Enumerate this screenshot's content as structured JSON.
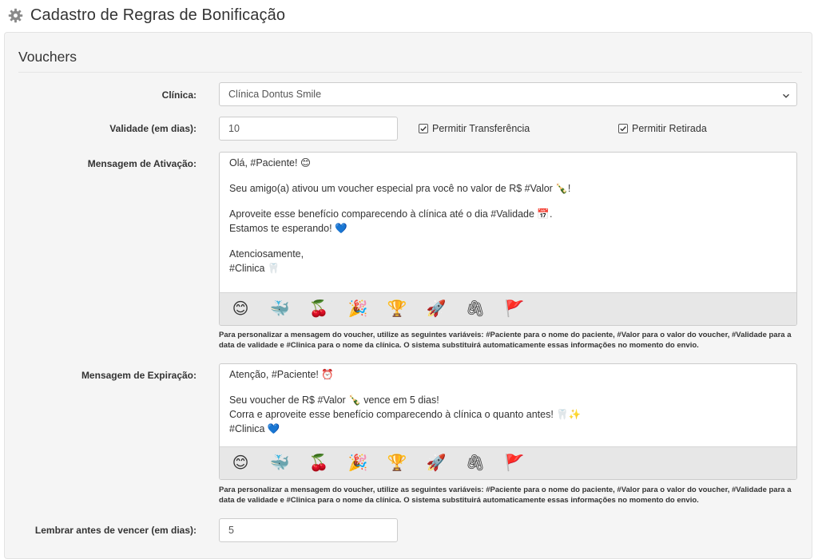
{
  "page": {
    "title": "Cadastro de Regras de Bonificação",
    "title_icon": "gear-icon"
  },
  "section": {
    "legend": "Vouchers"
  },
  "form": {
    "clinica": {
      "label": "Clínica:",
      "value": "Clínica Dontus Smile"
    },
    "validade": {
      "label": "Validade (em dias):",
      "value": "10"
    },
    "permitir_transferencia": {
      "label": "Permitir Transferência",
      "checked": true
    },
    "permitir_retirada": {
      "label": "Permitir Retirada",
      "checked": true
    },
    "ativacao": {
      "label": "Mensagem de Ativação:",
      "lines": [
        "Olá, #Paciente! 😊",
        "",
        "Seu amigo(a) ativou um voucher especial pra você no valor de R$ #Valor 🍾!",
        "",
        "Aproveite esse benefício comparecendo à clínica até o dia #Validade 📅.",
        "Estamos te esperando! 💙",
        "",
        "Atenciosamente,",
        "#Clinica 🦷"
      ]
    },
    "expiracao": {
      "label": "Mensagem de Expiração:",
      "lines": [
        "Atenção, #Paciente! ⏰",
        "",
        "Seu voucher de R$ #Valor 🍾 vence em 5 dias!",
        "Corra e aproveite esse benefício comparecendo à clínica o quanto antes! 🦷✨",
        "#Clinica 💙"
      ]
    },
    "help_text": "Para personalizar a mensagem do voucher, utilize as seguintes variáveis: #Paciente para o nome do paciente, #Valor para o valor do voucher, #Validade para a data de validade e #Clinica para o nome da clínica. O sistema substituirá automaticamente essas informações no momento do envio.",
    "lembrar": {
      "label": "Lembrar antes de vencer (em dias):",
      "value": "5"
    }
  },
  "emoji_bar": [
    {
      "name": "smiling-face-emoji",
      "glyph": "😊"
    },
    {
      "name": "whale-emoji",
      "glyph": "🐳"
    },
    {
      "name": "cherries-emoji",
      "glyph": "🍒"
    },
    {
      "name": "party-popper-emoji",
      "glyph": "🎉"
    },
    {
      "name": "trophy-emoji",
      "glyph": "🏆"
    },
    {
      "name": "rocket-emoji",
      "glyph": "🚀"
    },
    {
      "name": "paperclip-emoji",
      "glyph": "🖇"
    },
    {
      "name": "red-flag-emoji",
      "glyph": "🚩"
    }
  ],
  "colors": {
    "panel_bg": "#f5f5f5",
    "emoji_bar_bg": "#e7e7e7",
    "border": "#cccccc"
  }
}
